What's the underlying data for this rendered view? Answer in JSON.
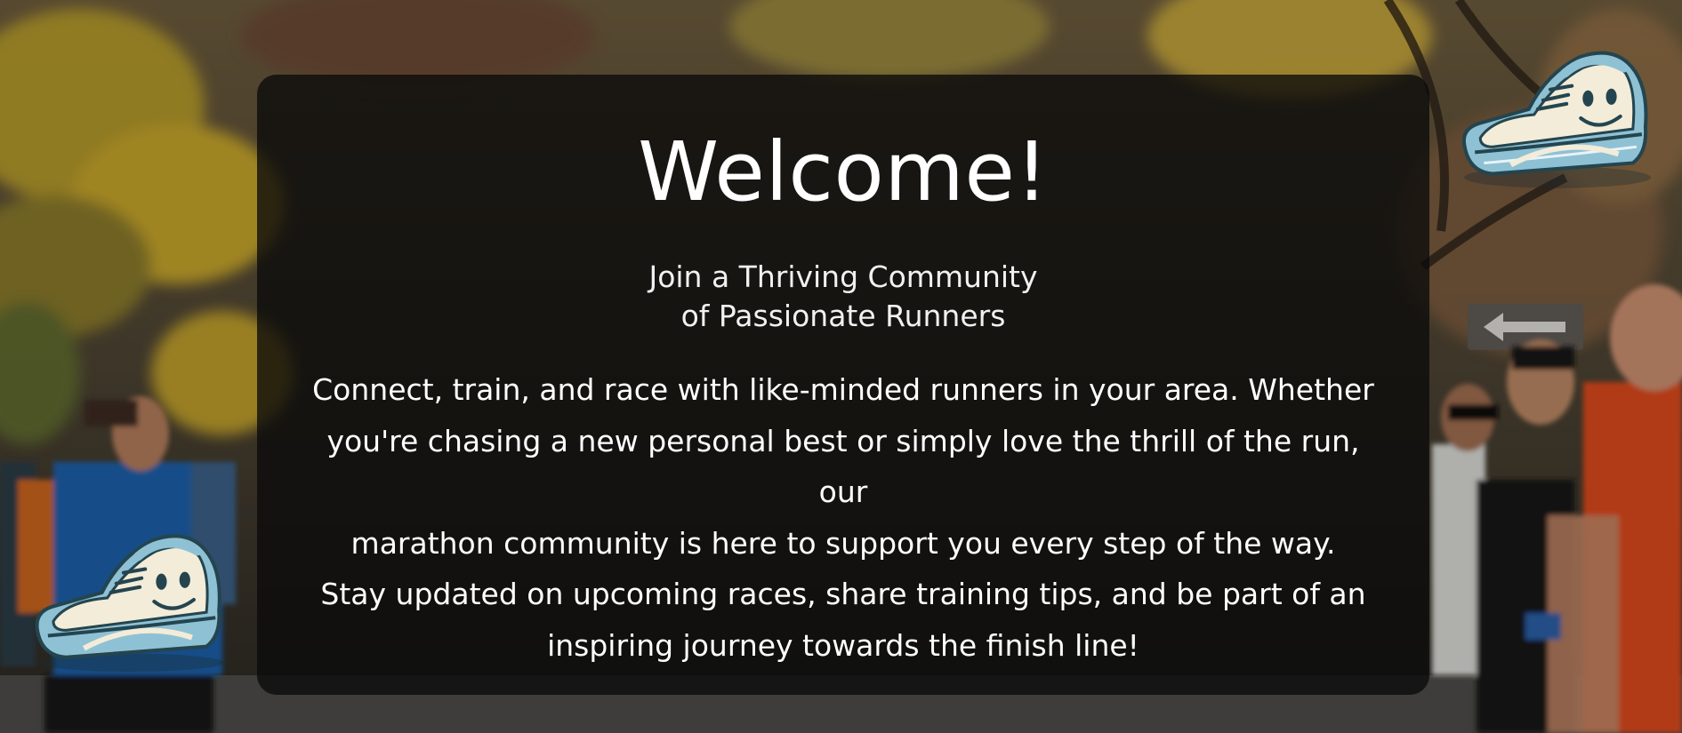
{
  "hero": {
    "title": "Welcome!",
    "subtitle_line1": "Join a Thriving Community",
    "subtitle_line2": "of Passionate Runners",
    "body_line1": "Connect, train, and race with like-minded runners in your area. Whether",
    "body_line2": "you're chasing a new personal best or simply love the thrill of the run, our",
    "body_line3": "marathon community is here to support you every step of the way.",
    "body_line4": "Stay updated on upcoming races, share training tips, and be part of an",
    "body_line5": "inspiring journey towards the finish line!"
  },
  "decorations": {
    "sneaker_icon": "smiling-sneaker-icon",
    "background": "marathon-runners-photo"
  },
  "colors": {
    "card_background": "#0a0a0a",
    "text": "#ffffff",
    "sneaker_blue": "#8fc1d4",
    "sneaker_cream": "#f3ecd8"
  }
}
